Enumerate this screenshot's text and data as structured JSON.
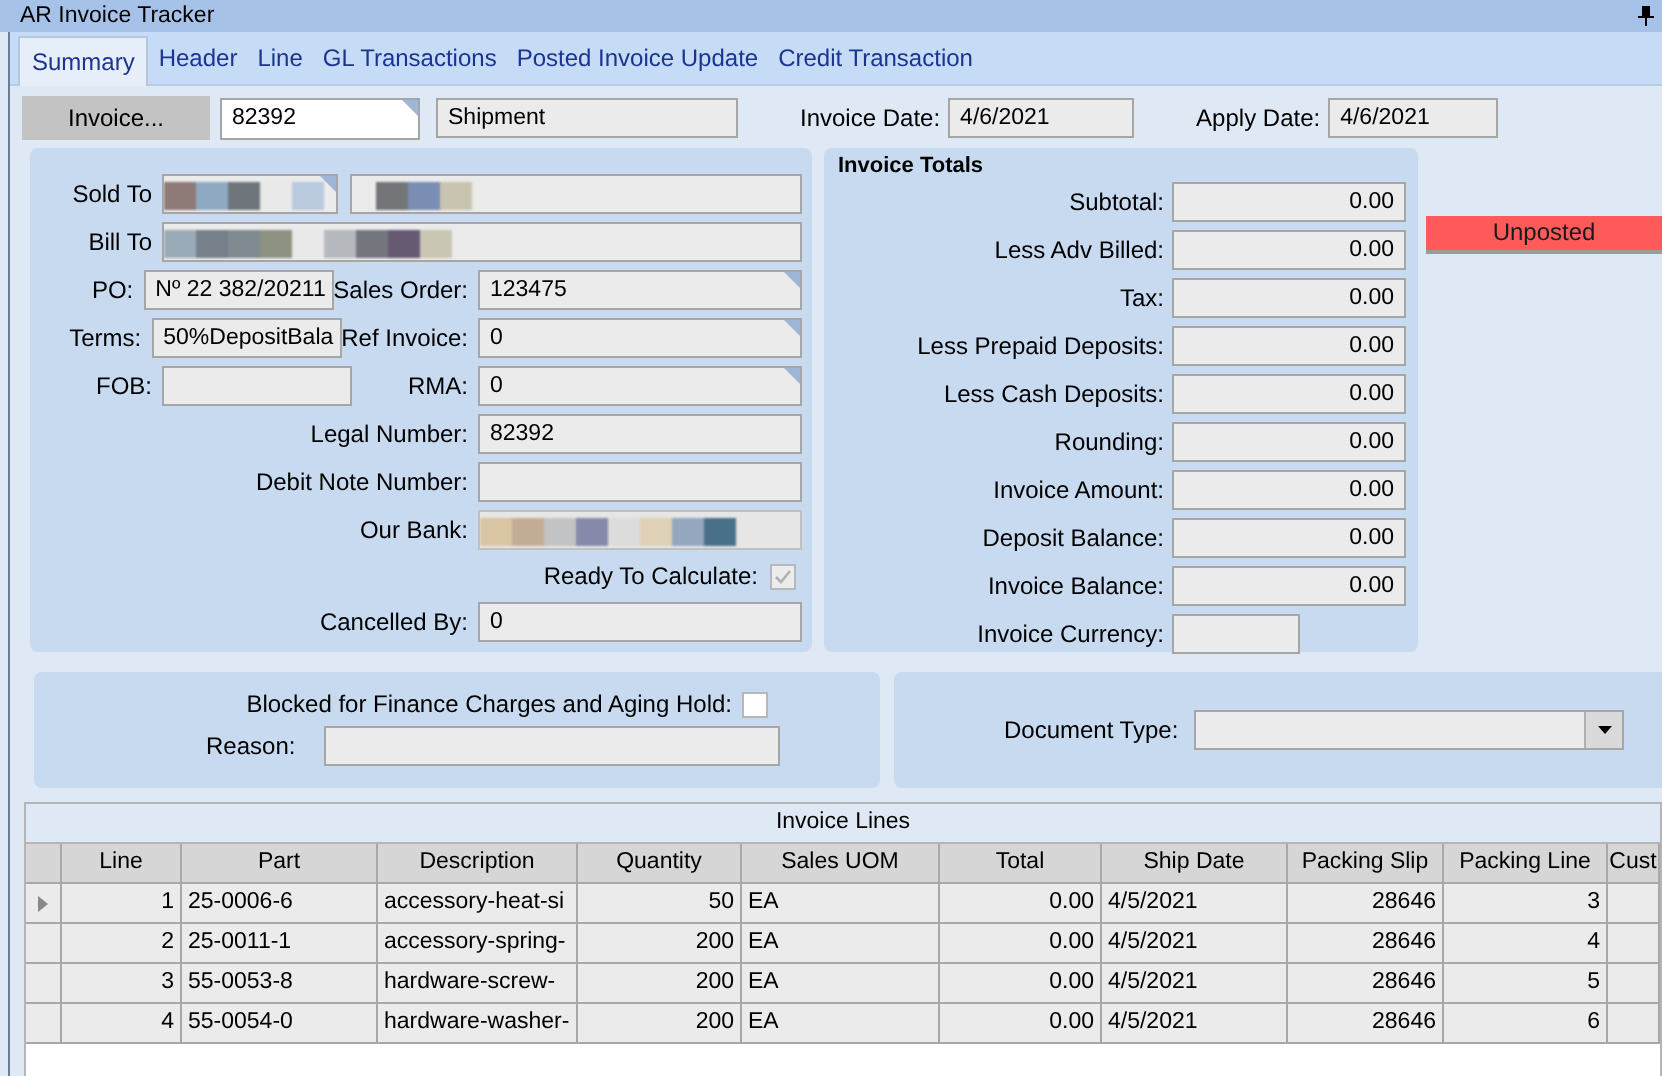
{
  "window": {
    "title": "AR Invoice Tracker"
  },
  "tabs": [
    {
      "label": "Summary",
      "selected": true
    },
    {
      "label": "Header",
      "selected": false
    },
    {
      "label": "Line",
      "selected": false
    },
    {
      "label": "GL Transactions",
      "selected": false
    },
    {
      "label": "Posted Invoice Update",
      "selected": false
    },
    {
      "label": "Credit Transaction",
      "selected": false
    }
  ],
  "header": {
    "invoice_button": "Invoice...",
    "invoice_number": {
      "value": "82392",
      "linked": true
    },
    "type": "Shipment",
    "invoice_date": {
      "label": "Invoice Date:",
      "value": "4/6/2021"
    },
    "apply_date": {
      "label": "Apply Date:",
      "value": "4/6/2021"
    }
  },
  "details": {
    "sold_to": {
      "label": "Sold To",
      "linked": true
    },
    "bill_to": {
      "label": "Bill To"
    },
    "po": {
      "label": "PO:",
      "value": "Nº 22 382/20211"
    },
    "sales_order": {
      "label": "Sales Order:",
      "value": "123475",
      "linked": true
    },
    "terms": {
      "label": "Terms:",
      "value": "50%DepositBala"
    },
    "ref_invoice": {
      "label": "Ref Invoice:",
      "value": "0",
      "linked": true
    },
    "fob": {
      "label": "FOB:"
    },
    "rma": {
      "label": "RMA:",
      "value": "0",
      "linked": true
    },
    "legal_number": {
      "label": "Legal Number:",
      "value": "82392"
    },
    "debit_note_number": {
      "label": "Debit Note Number:"
    },
    "our_bank": {
      "label": "Our Bank:"
    },
    "ready_to_calculate": {
      "label": "Ready To Calculate:",
      "checked": true,
      "disabled": true
    },
    "cancelled_by": {
      "label": "Cancelled By:",
      "value": "0"
    }
  },
  "totals": {
    "title": "Invoice Totals",
    "rows": [
      {
        "label": "Subtotal:",
        "value": "0.00"
      },
      {
        "label": "Less Adv Billed:",
        "value": "0.00"
      },
      {
        "label": "Tax:",
        "value": "0.00"
      },
      {
        "label": "Less Prepaid Deposits:",
        "value": "0.00"
      },
      {
        "label": "Less Cash Deposits:",
        "value": "0.00"
      },
      {
        "label": "Rounding:",
        "value": "0.00"
      },
      {
        "label": "Invoice Amount:",
        "value": "0.00"
      },
      {
        "label": "Deposit Balance:",
        "value": "0.00"
      },
      {
        "label": "Invoice Balance:",
        "value": "0.00"
      }
    ],
    "currency_label": "Invoice Currency:"
  },
  "status": {
    "label": "Unposted",
    "posted": false
  },
  "hold": {
    "label": "Blocked for Finance Charges and Aging Hold:",
    "checked": false,
    "reason_label": "Reason:"
  },
  "document_type": {
    "label": "Document Type:"
  },
  "lines": {
    "title": "Invoice Lines",
    "columns": [
      "Line",
      "Part",
      "Description",
      "Quantity",
      "Sales UOM",
      "Total",
      "Ship Date",
      "Packing Slip",
      "Packing Line",
      "Cust"
    ],
    "rows": [
      {
        "selected": true,
        "cells": [
          "1",
          "25-0006-6",
          "accessory-heat-si",
          "50",
          "EA",
          "0.00",
          "4/5/2021",
          "28646",
          "3"
        ]
      },
      {
        "selected": false,
        "cells": [
          "2",
          "25-0011-1",
          "accessory-spring-",
          "200",
          "EA",
          "0.00",
          "4/5/2021",
          "28646",
          "4"
        ]
      },
      {
        "selected": false,
        "cells": [
          "3",
          "55-0053-8",
          "hardware-screw-",
          "200",
          "EA",
          "0.00",
          "4/5/2021",
          "28646",
          "5"
        ]
      },
      {
        "selected": false,
        "cells": [
          "4",
          "55-0054-0",
          "hardware-washer-",
          "200",
          "EA",
          "0.00",
          "4/5/2021",
          "28646",
          "6"
        ]
      }
    ]
  }
}
